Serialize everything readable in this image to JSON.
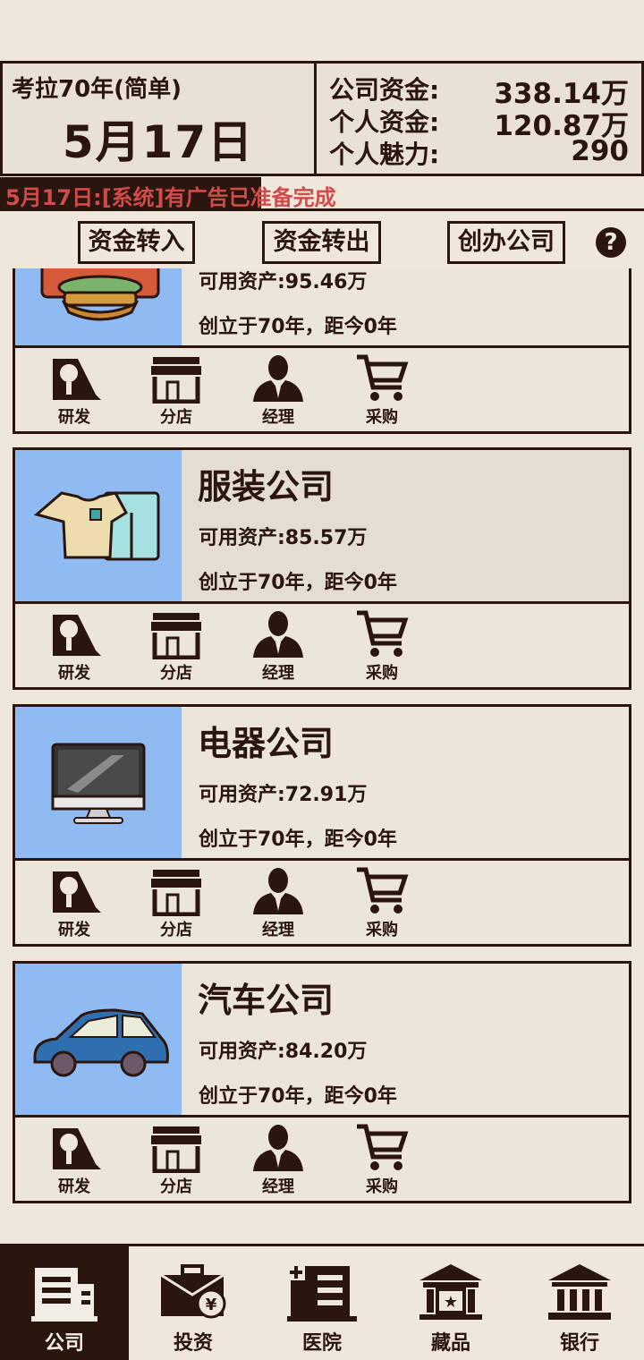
{
  "header": {
    "game_title": "考拉70年(简单)",
    "date": "5月17日",
    "stats": [
      {
        "label": "公司资金:",
        "value": "338.14万"
      },
      {
        "label": "个人资金:",
        "value": "120.87万"
      },
      {
        "label": "个人魅力:",
        "value": "290"
      }
    ]
  },
  "ticker": {
    "message": "5月17日:[系统]有广告已准备完成"
  },
  "actions": {
    "transfer_in": "资金转入",
    "transfer_out": "资金转出",
    "create_company": "创办公司"
  },
  "company_actions": {
    "research": "研发",
    "branch": "分店",
    "manager": "经理",
    "purchase": "采购"
  },
  "companies": [
    {
      "name": "",
      "assets": "可用资产:95.46万",
      "founded": "创立于70年，距今0年",
      "icon": "burger-icon"
    },
    {
      "name": "服装公司",
      "assets": "可用资产:85.57万",
      "founded": "创立于70年，距今0年",
      "icon": "clothing-icon"
    },
    {
      "name": "电器公司",
      "assets": "可用资产:72.91万",
      "founded": "创立于70年，距今0年",
      "icon": "monitor-icon"
    },
    {
      "name": "汽车公司",
      "assets": "可用资产:84.20万",
      "founded": "创立于70年，距今0年",
      "icon": "car-icon"
    }
  ],
  "nav": [
    {
      "label": "公司",
      "icon": "company-building-icon",
      "active": true
    },
    {
      "label": "投资",
      "icon": "investment-briefcase-icon",
      "active": false
    },
    {
      "label": "医院",
      "icon": "hospital-icon",
      "active": false
    },
    {
      "label": "藏品",
      "icon": "museum-icon",
      "active": false
    },
    {
      "label": "银行",
      "icon": "bank-icon",
      "active": false
    }
  ],
  "colors": {
    "ink": "#2b150f",
    "background": "#efe7d9",
    "thumb_bg": "#8fbaf2",
    "ticker_text": "#d24b4b"
  }
}
